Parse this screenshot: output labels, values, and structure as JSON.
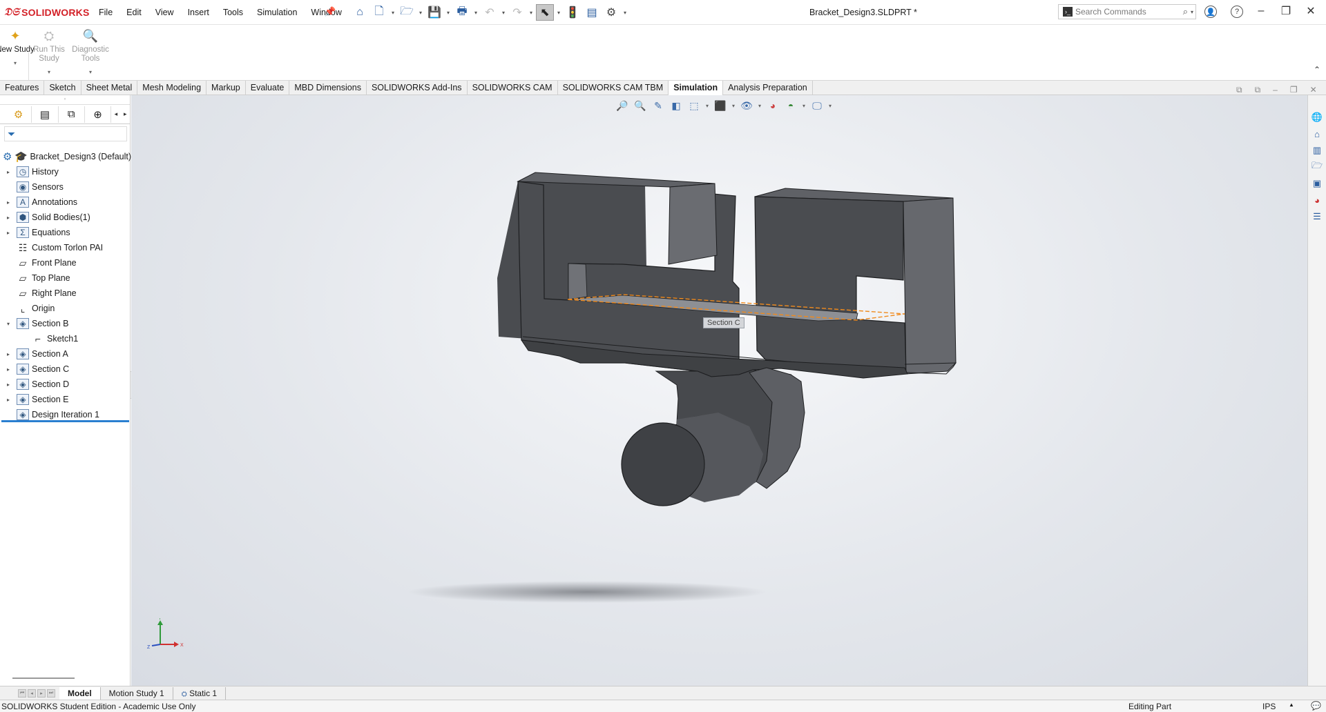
{
  "app": {
    "brand": "SOLIDWORKS",
    "document_title": "Bracket_Design3.SLDPRT *",
    "search_placeholder": "Search Commands"
  },
  "menus": [
    "File",
    "Edit",
    "View",
    "Insert",
    "Tools",
    "Simulation",
    "Window"
  ],
  "ribbon": {
    "new_study": "New Study",
    "run_study": "Run This Study",
    "diagnostic": "Diagnostic Tools"
  },
  "tabs": [
    "Features",
    "Sketch",
    "Sheet Metal",
    "Mesh Modeling",
    "Markup",
    "Evaluate",
    "MBD Dimensions",
    "SOLIDWORKS Add-Ins",
    "SOLIDWORKS CAM",
    "SOLIDWORKS CAM TBM",
    "Simulation",
    "Analysis Preparation"
  ],
  "active_tab": "Simulation",
  "tree": {
    "root": "Bracket_Design3 (Default)",
    "items": [
      {
        "label": "History",
        "expandable": true
      },
      {
        "label": "Sensors",
        "expandable": false
      },
      {
        "label": "Annotations",
        "expandable": true
      },
      {
        "label": "Solid Bodies(1)",
        "expandable": true
      },
      {
        "label": "Equations",
        "expandable": true
      },
      {
        "label": "Custom Torlon PAI",
        "expandable": false
      },
      {
        "label": "Front Plane",
        "expandable": false
      },
      {
        "label": "Top Plane",
        "expandable": false
      },
      {
        "label": "Right Plane",
        "expandable": false
      },
      {
        "label": "Origin",
        "expandable": false
      },
      {
        "label": "Section B",
        "expandable": true,
        "expanded": true
      },
      {
        "label": "Sketch1",
        "expandable": false,
        "child": true
      },
      {
        "label": "Section A",
        "expandable": true
      },
      {
        "label": "Section C",
        "expandable": true
      },
      {
        "label": "Section D",
        "expandable": true
      },
      {
        "label": "Section E",
        "expandable": true
      },
      {
        "label": "Design Iteration 1",
        "expandable": false
      }
    ]
  },
  "viewport": {
    "section_label": "Section C",
    "triad": {
      "y": "Y",
      "x": "X",
      "z": "Z"
    }
  },
  "bottom_tabs": [
    "Model",
    "Motion Study 1",
    "Static 1"
  ],
  "status": {
    "left": "SOLIDWORKS Student Edition - Academic Use Only",
    "mode": "Editing Part",
    "units": "IPS"
  },
  "colors": {
    "brand_red": "#d32027",
    "accent_blue": "#2a7fd0",
    "model_gray": "#555555",
    "section_highlight": "#f08a1c"
  }
}
